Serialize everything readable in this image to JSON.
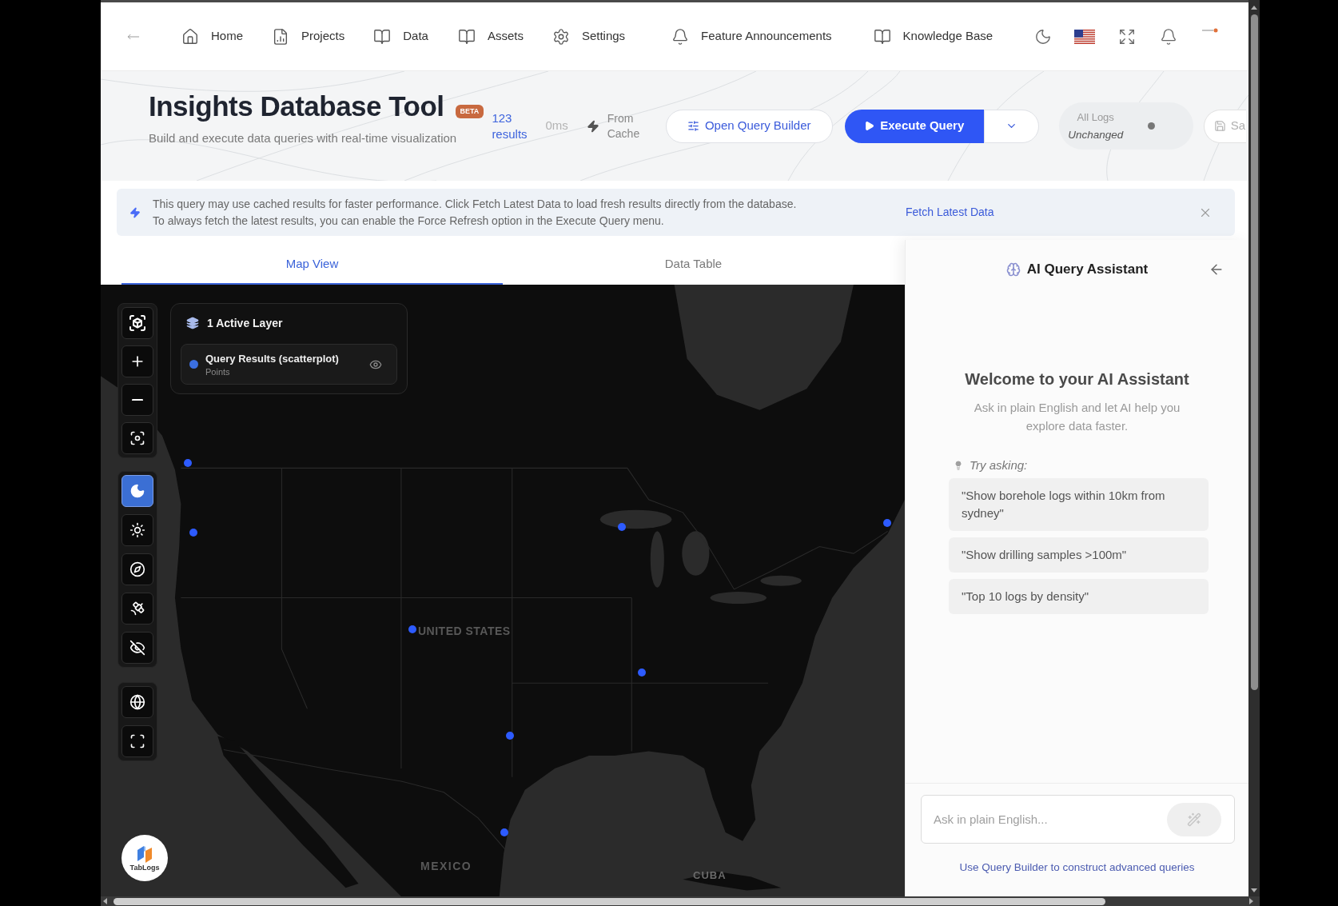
{
  "nav": {
    "items": [
      {
        "label": "Home"
      },
      {
        "label": "Projects"
      },
      {
        "label": "Data"
      },
      {
        "label": "Assets"
      },
      {
        "label": "Settings"
      },
      {
        "label": "Feature Announcements"
      },
      {
        "label": "Knowledge Base"
      }
    ]
  },
  "header": {
    "title": "Insights Database Tool",
    "badge": "BETA",
    "subtitle": "Build and execute data queries with real-time visualization",
    "results": "123 results",
    "duration": "0ms",
    "source": "From Cache"
  },
  "toolbar": {
    "query_builder_button": "Open Query Builder",
    "execute_button": "Execute Query",
    "log_filter": {
      "label": "All Logs",
      "status": "Unchanged"
    },
    "save_button": "Sa"
  },
  "notice": {
    "messages": [
      "This query may use cached results for faster performance. Click Fetch Latest Data to load fresh results directly from the database.",
      "To always fetch the latest results, you can enable the Force Refresh option in the Execute Query menu."
    ],
    "link": "Fetch Latest Data"
  },
  "tabs": [
    {
      "label": "Map View",
      "selected": true
    },
    {
      "label": "Data Table",
      "selected": false
    }
  ],
  "map": {
    "style_buttons": [
      {
        "selected": true
      },
      {
        "selected": false
      },
      {
        "selected": false
      },
      {
        "selected": false
      }
    ],
    "layers_panel": {
      "title": "1 Active Layer",
      "layers": [
        {
          "name": "Query Results (scatterplot)",
          "geometry": "Points",
          "color": "#3b6fe0",
          "visible": true
        }
      ]
    },
    "labels": [
      "UNITED STATES",
      "MEXICO",
      "CUBA"
    ],
    "logo": "TabLogs"
  },
  "assistant": {
    "title": "AI Query Assistant",
    "welcome_title": "Welcome to your AI Assistant",
    "welcome_text": "Ask in plain English and let AI help you explore data faster.",
    "prompt_label": "Try asking:",
    "suggestions": [
      "\"Show borehole logs within 10km from sydney\"",
      "\"Show drilling samples >100m\"",
      "\"Top 10 logs by density\""
    ],
    "input": {
      "placeholder": "Ask in plain English..."
    },
    "footer_link": "Use Query Builder to construct advanced queries"
  }
}
